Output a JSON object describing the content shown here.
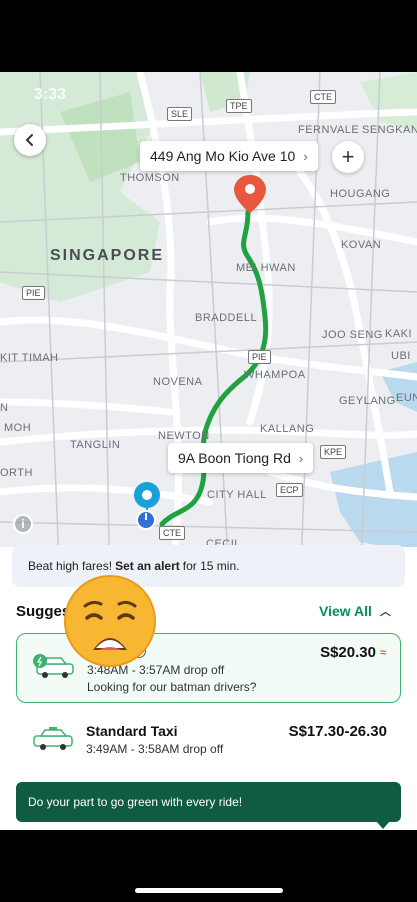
{
  "status": {
    "time": "3:33"
  },
  "map": {
    "labels": {
      "singapore": "SINGAPORE",
      "thomson": "THOMSON",
      "hougang": "HOUGANG",
      "kovan": "KOVAN",
      "mei_hwan": "MEI HWAN",
      "braddell": "BRADDELL",
      "joo_seng": "JOO SENG",
      "kaki": "KAKI",
      "ubi": "UBI",
      "bukit_timah": "KIT TIMAH",
      "novena": "NOVENA",
      "whampoa": "WHAMPOA",
      "geylang": "GEYLANG",
      "eun": "EUN",
      "moh": "MOH",
      "n_left": "N",
      "tanglin": "TANGLIN",
      "newton": "NEWTON",
      "kallang": "KALLANG",
      "orth": "ORTH",
      "city_hall": "CITY HALL",
      "fernvale": "FERNVALE",
      "sengkang": "SENGKANG",
      "cecil": "CECIL"
    },
    "shields": {
      "tpe": "TPE",
      "sle": "SLE",
      "cte_top": "CTE",
      "pie_left": "PIE",
      "pie_mid": "PIE",
      "kpe": "KPE",
      "ecp": "ECP",
      "cte_bottom": "CTE"
    },
    "pickup": "449 Ang Mo Kio Ave 10",
    "dropoff": "9A Boon Tiong Rd",
    "route_color": "#1fa23f",
    "pin_color": "#e8583f"
  },
  "alert": {
    "prefix": "Beat high fares!",
    "bold": "Set an alert",
    "suffix": "for 15 min."
  },
  "suggestions": {
    "heading": "Sugges",
    "view_all": "View All"
  },
  "options": [
    {
      "time": "3:48AM - 3:57AM drop off",
      "note": "Looking for our batman drivers?",
      "price": "S$20.30"
    },
    {
      "title": "Standard Taxi",
      "time": "3:49AM - 3:58AM drop off",
      "price": "S$17.30-26.30"
    }
  ],
  "toast": "Do your part to go green with every ride!"
}
